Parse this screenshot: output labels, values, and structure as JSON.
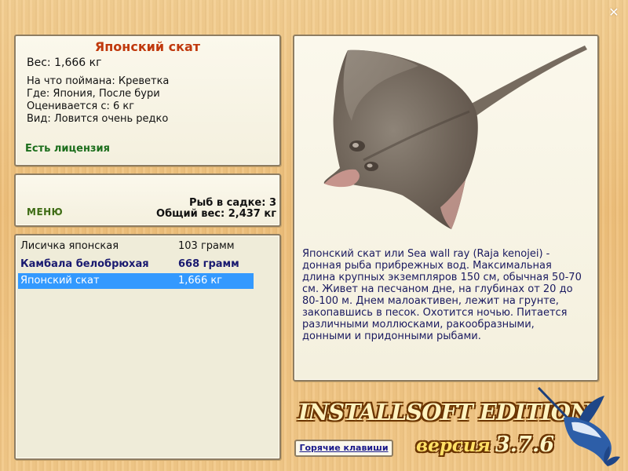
{
  "window": {
    "close_symbol": "✕"
  },
  "info": {
    "title": "Японский скат",
    "weight": "Вес: 1,666 кг",
    "details": [
      "На что поймана: Креветка",
      "Где: Япония, После бури",
      "Оценивается с: 6 кг",
      "Вид: Ловится очень редко"
    ],
    "license": "Есть лицензия"
  },
  "menu": {
    "label": "МЕНЮ",
    "fish_count": "Рыб в садке: 3",
    "total_weight": "Общий вес: 2,437 кг"
  },
  "catch_list": [
    {
      "name": "Лисичка японская",
      "weight": "103 грамм",
      "style": "normal"
    },
    {
      "name": "Камбала белобрюхая",
      "weight": "668 грамм",
      "style": "bold"
    },
    {
      "name": "Японский скат",
      "weight": "1,666 кг",
      "style": "selected"
    }
  ],
  "description": "Японский скат или Sea wall ray (Raja kenojei) - донная рыба прибрежных вод. Максимальная длина крупных экземпляров 150 см, обычная 50-70 см. Живет на песчаном дне, на глубинах от 20 до 80-100 м. Днем малоактивен, лежит на грунте, закопавшись в песок. Охотится ночью. Питается различными моллюсками, ракообразными, донными и придонными рыбами.",
  "brand": {
    "name": "INSTALLSOFT EDITION",
    "version_label": "версия",
    "version_number": "3.7.6"
  },
  "hotkeys_label": "Горячие клавиши",
  "colors": {
    "title": "#c0390d",
    "license": "#1c6e1c",
    "selection": "#3399ff",
    "bold_row": "#1a1a70",
    "background": "#eec07c"
  },
  "icons": {
    "close": "close-icon",
    "fish": "stingray-image",
    "logo": "marlin-icon"
  }
}
